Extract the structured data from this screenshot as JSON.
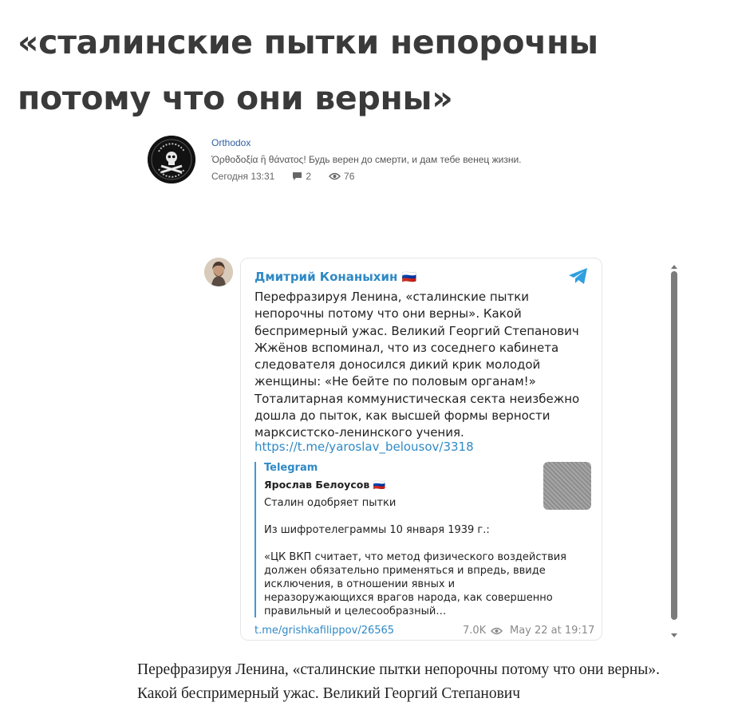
{
  "article": {
    "title": "«сталинские пытки непорочны потому что они верны»",
    "body_excerpt": "Перефразируя Ленина, «сталинские пытки непорочны потому что они верны». Какой беспримерный ужас. Великий Георгий Степанович"
  },
  "author": {
    "name": "Orthodox",
    "motto": "Ὀρθοδοξία ἢ θάνατος! Будь верен до смерти, и дам тебе венец жизни.",
    "time": "Сегодня 13:31",
    "comments": "2",
    "views": "76"
  },
  "telegram": {
    "channel": "Дмитрий Конаныхин 🇷🇺",
    "text": "Перефразируя Ленина, «сталинские пытки непорочны потому что они верны». Какой беспримерный ужас. Великий Георгий Степанович Жжёнов вспоминал, что из соседнего кабинета следователя доносился дикий крик молодой женщины: «Не бейте по половым органам!» Тоталитарная коммунистическая секта неизбежно дошла до пыток, как высшей формы верности марксистско-ленинского учения.",
    "link": "https://t.me/yaroslav_belousov/3318",
    "preview": {
      "source": "Telegram",
      "author": "Ярослав Белоусов 🇷🇺",
      "line1": "Сталин одобряет пытки",
      "line2": "Из шифротелеграммы 10 января 1939 г.:",
      "body": "«ЦК ВКП считает, что метод физического воздействия должен обязательно применяться и впредь, ввиде исключения, в отношении явных и неразоружающихся врагов народа, как совершенно правильный и целесообразный…"
    },
    "footer_link": "t.me/grishkafilippov/26565",
    "views": "7.0K",
    "date": "May 22 at 19:17",
    "accent_color": "#2f89c5"
  }
}
